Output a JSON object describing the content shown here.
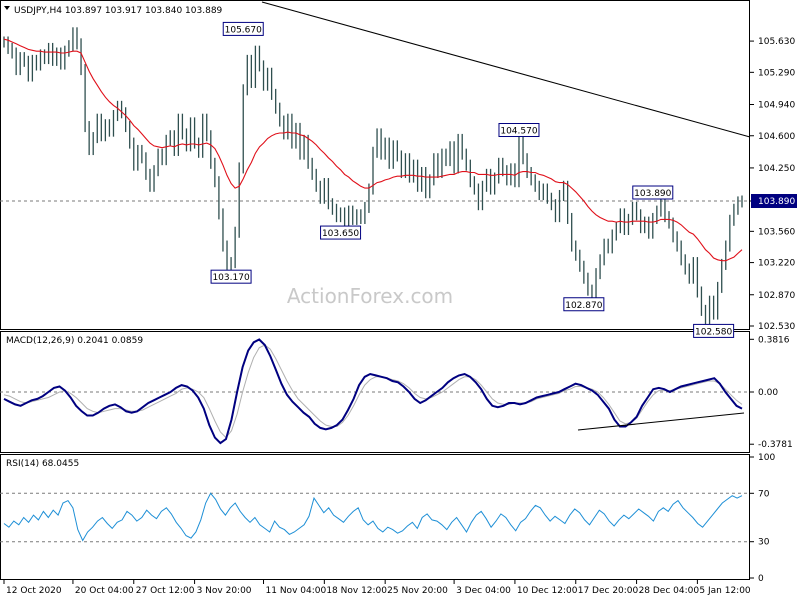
{
  "colors": {
    "price_bar": "#2f4f4f",
    "ma_line": "#e0101a",
    "macd_line": "#000080",
    "signal_line": "#b0b0b0",
    "rsi_line": "#1e8fd6",
    "trendline": "#000000",
    "label_border": "#000080",
    "current_price_bg": "#000080",
    "grid_dashed": "#7a7a7a"
  },
  "watermark": "ActionForex.com",
  "chart_data": [
    {
      "type": "line",
      "title": "USDJPY,H4 103.897 103.917 103.840 103.889",
      "y_ticks": [
        "105.630",
        "105.290",
        "104.940",
        "104.600",
        "104.250",
        "103.890",
        "103.560",
        "103.220",
        "102.870",
        "102.530"
      ],
      "ylim": [
        102.53,
        105.99
      ],
      "current_price": "103.890",
      "annotations": [
        {
          "label": "105.670",
          "x_index": 59,
          "y": 105.67
        },
        {
          "label": "103.170",
          "x_index": 56,
          "y": 103.17
        },
        {
          "label": "103.650",
          "x_index": 83,
          "y": 103.65
        },
        {
          "label": "104.570",
          "x_index": 127,
          "y": 104.57
        },
        {
          "label": "102.870",
          "x_index": 143,
          "y": 102.87
        },
        {
          "label": "103.890",
          "x_index": 160,
          "y": 103.89
        },
        {
          "label": "102.580",
          "x_index": 175,
          "y": 102.58
        }
      ],
      "series": [
        {
          "values": [
            105.62,
            105.55,
            105.5,
            105.32,
            105.45,
            105.41,
            105.25,
            105.42,
            105.37,
            105.48,
            105.44,
            105.55,
            105.42,
            105.5,
            105.38,
            105.52,
            105.58,
            105.72,
            105.6,
            105.32,
            104.7,
            104.45,
            104.58,
            104.78,
            104.6,
            104.72,
            104.65,
            104.82,
            104.92,
            104.85,
            104.7,
            104.52,
            104.28,
            104.44,
            104.36,
            104.18,
            104.05,
            104.22,
            104.4,
            104.34,
            104.55,
            104.6,
            104.44,
            104.78,
            104.62,
            104.49,
            104.74,
            104.52,
            104.42,
            104.78,
            104.6,
            104.3,
            104.1,
            103.75,
            103.4,
            103.2,
            103.22,
            103.55,
            104.25,
            105.1,
            105.42,
            105.18,
            105.52,
            105.36,
            105.15,
            105.28,
            105.05,
            104.9,
            104.76,
            104.62,
            104.78,
            104.52,
            104.68,
            104.4,
            104.55,
            104.3,
            104.18,
            104.05,
            103.92,
            104.08,
            103.86,
            103.8,
            103.72,
            103.76,
            103.65,
            103.78,
            103.69,
            103.74,
            103.7,
            103.82,
            104.02,
            104.42,
            104.62,
            104.4,
            104.52,
            104.3,
            104.49,
            104.38,
            104.2,
            104.35,
            104.15,
            104.28,
            104.05,
            104.2,
            103.98,
            104.12,
            104.35,
            104.2,
            104.4,
            104.33,
            104.48,
            104.25,
            104.56,
            104.4,
            104.28,
            104.1,
            104.02,
            103.85,
            104.05,
            104.18,
            104.02,
            104.14,
            104.3,
            104.22,
            104.12,
            104.24,
            104.1,
            104.57,
            104.35,
            104.2,
            104.12,
            104.05,
            103.96,
            104.02,
            103.92,
            103.85,
            103.72,
            103.95,
            104.05,
            103.7,
            103.4,
            103.3,
            103.18,
            103.05,
            102.92,
            102.87,
            103.1,
            103.25,
            103.42,
            103.38,
            103.52,
            103.6,
            103.75,
            103.58,
            103.69,
            103.82,
            103.74,
            103.6,
            103.66,
            103.54,
            103.7,
            103.78,
            103.89,
            103.72,
            103.65,
            103.5,
            103.4,
            103.25,
            103.15,
            103.05,
            103.22,
            102.9,
            102.7,
            102.58,
            102.8,
            102.66,
            102.95,
            103.2,
            103.4,
            103.68,
            103.8,
            103.88,
            103.89
          ]
        },
        {
          "values": [
            105.65,
            105.64,
            105.62,
            105.6,
            105.58,
            105.56,
            105.54,
            105.53,
            105.52,
            105.52,
            105.51,
            105.51,
            105.51,
            105.51,
            105.5,
            105.5,
            105.51,
            105.52,
            105.52,
            105.5,
            105.4,
            105.3,
            105.22,
            105.15,
            105.08,
            105.02,
            104.97,
            104.93,
            104.9,
            104.86,
            104.82,
            104.77,
            104.71,
            104.67,
            104.62,
            104.57,
            104.52,
            104.49,
            104.48,
            104.47,
            104.48,
            104.49,
            104.48,
            104.5,
            104.51,
            104.5,
            104.51,
            104.51,
            104.5,
            104.51,
            104.52,
            104.5,
            104.46,
            104.38,
            104.28,
            104.17,
            104.08,
            104.03,
            104.05,
            104.13,
            104.23,
            104.31,
            104.41,
            104.48,
            104.52,
            104.57,
            104.6,
            104.62,
            104.63,
            104.63,
            104.64,
            104.63,
            104.63,
            104.61,
            104.6,
            104.57,
            104.54,
            104.5,
            104.45,
            104.41,
            104.36,
            104.32,
            104.27,
            104.23,
            104.18,
            104.15,
            104.11,
            104.08,
            104.05,
            104.03,
            104.03,
            104.06,
            104.09,
            104.1,
            104.12,
            104.13,
            104.15,
            104.16,
            104.16,
            104.17,
            104.17,
            104.17,
            104.16,
            104.16,
            104.15,
            104.15,
            104.15,
            104.15,
            104.16,
            104.17,
            104.18,
            104.18,
            104.2,
            104.21,
            104.21,
            104.2,
            104.2,
            104.18,
            104.18,
            104.18,
            104.17,
            104.17,
            104.18,
            104.18,
            104.18,
            104.18,
            104.17,
            104.2,
            104.21,
            104.21,
            104.2,
            104.2,
            104.18,
            104.17,
            104.15,
            104.13,
            104.1,
            104.09,
            104.09,
            104.07,
            104.03,
            103.99,
            103.94,
            103.89,
            103.83,
            103.78,
            103.74,
            103.71,
            103.69,
            103.67,
            103.67,
            103.66,
            103.67,
            103.66,
            103.66,
            103.67,
            103.67,
            103.67,
            103.67,
            103.66,
            103.66,
            103.67,
            103.69,
            103.69,
            103.69,
            103.68,
            103.66,
            103.63,
            103.59,
            103.55,
            103.53,
            103.48,
            103.42,
            103.36,
            103.32,
            103.27,
            103.25,
            103.24,
            103.24,
            103.26,
            103.28,
            103.32,
            103.36
          ]
        }
      ],
      "x_ticks": [
        {
          "label": "12 Oct 2020",
          "x_index": 0
        },
        {
          "label": "20 Oct 04:00",
          "x_index": 17
        },
        {
          "label": "27 Oct 12:00",
          "x_index": 32
        },
        {
          "label": "3 Nov 20:00",
          "x_index": 47
        },
        {
          "label": "11 Nov 04:00",
          "x_index": 64
        },
        {
          "label": "18 Nov 12:00",
          "x_index": 79
        },
        {
          "label": "25 Nov 20:00",
          "x_index": 94
        },
        {
          "label": "3 Dec 04:00",
          "x_index": 111
        },
        {
          "label": "10 Dec 12:00",
          "x_index": 126
        },
        {
          "label": "17 Dec 20:00",
          "x_index": 141
        },
        {
          "label": "28 Dec 04:00",
          "x_index": 156
        },
        {
          "label": "5 Jan 12:00",
          "x_index": 171
        }
      ]
    },
    {
      "type": "line",
      "title": "MACD(12,26,9) 0.2041 0.0859",
      "y_ticks": [
        "0.3816",
        "0.00",
        "-0.3781"
      ],
      "ylim": [
        -0.42,
        0.42
      ],
      "series": [
        {
          "values": [
            -0.05,
            -0.07,
            -0.09,
            -0.1,
            -0.08,
            -0.06,
            -0.05,
            -0.03,
            0.0,
            0.03,
            0.04,
            0.01,
            -0.04,
            -0.1,
            -0.14,
            -0.17,
            -0.17,
            -0.15,
            -0.12,
            -0.1,
            -0.09,
            -0.11,
            -0.14,
            -0.15,
            -0.14,
            -0.11,
            -0.08,
            -0.06,
            -0.04,
            -0.02,
            0.0,
            0.03,
            0.05,
            0.04,
            0.01,
            -0.04,
            -0.12,
            -0.24,
            -0.33,
            -0.37,
            -0.34,
            -0.2,
            0.0,
            0.18,
            0.3,
            0.36,
            0.38,
            0.34,
            0.26,
            0.16,
            0.06,
            -0.02,
            -0.07,
            -0.11,
            -0.15,
            -0.18,
            -0.23,
            -0.26,
            -0.27,
            -0.26,
            -0.24,
            -0.2,
            -0.13,
            -0.05,
            0.05,
            0.11,
            0.13,
            0.12,
            0.11,
            0.1,
            0.08,
            0.07,
            0.04,
            0.0,
            -0.05,
            -0.08,
            -0.06,
            -0.03,
            0.0,
            0.03,
            0.07,
            0.1,
            0.12,
            0.13,
            0.11,
            0.07,
            0.02,
            -0.05,
            -0.1,
            -0.11,
            -0.1,
            -0.08,
            -0.08,
            -0.09,
            -0.08,
            -0.06,
            -0.04,
            -0.03,
            -0.02,
            -0.01,
            0.0,
            0.02,
            0.04,
            0.06,
            0.05,
            0.03,
            0.01,
            -0.02,
            -0.07,
            -0.12,
            -0.2,
            -0.25,
            -0.25,
            -0.22,
            -0.18,
            -0.1,
            -0.04,
            0.02,
            0.03,
            0.02,
            0.0,
            0.02,
            0.04,
            0.05,
            0.06,
            0.07,
            0.08,
            0.09,
            0.1,
            0.06,
            0.0,
            -0.05,
            -0.1,
            -0.12
          ],
          "name": ""
        },
        {
          "values": [
            -0.02,
            -0.03,
            -0.05,
            -0.07,
            -0.08,
            -0.07,
            -0.06,
            -0.05,
            -0.04,
            -0.02,
            0.0,
            0.01,
            -0.01,
            -0.04,
            -0.08,
            -0.12,
            -0.14,
            -0.15,
            -0.14,
            -0.13,
            -0.12,
            -0.12,
            -0.13,
            -0.14,
            -0.14,
            -0.13,
            -0.11,
            -0.09,
            -0.07,
            -0.05,
            -0.03,
            -0.01,
            0.02,
            0.03,
            0.02,
            0.0,
            -0.04,
            -0.12,
            -0.21,
            -0.29,
            -0.33,
            -0.28,
            -0.16,
            0.0,
            0.14,
            0.25,
            0.32,
            0.34,
            0.31,
            0.24,
            0.16,
            0.08,
            0.01,
            -0.05,
            -0.09,
            -0.13,
            -0.17,
            -0.21,
            -0.24,
            -0.25,
            -0.25,
            -0.22,
            -0.17,
            -0.1,
            -0.02,
            0.05,
            0.09,
            0.11,
            0.11,
            0.1,
            0.09,
            0.08,
            0.06,
            0.03,
            -0.01,
            -0.04,
            -0.05,
            -0.04,
            -0.02,
            0.0,
            0.03,
            0.06,
            0.09,
            0.11,
            0.11,
            0.09,
            0.05,
            0.0,
            -0.05,
            -0.08,
            -0.09,
            -0.09,
            -0.08,
            -0.08,
            -0.08,
            -0.07,
            -0.05,
            -0.04,
            -0.03,
            -0.02,
            -0.01,
            0.01,
            0.02,
            0.04,
            0.04,
            0.03,
            0.02,
            0.0,
            -0.04,
            -0.09,
            -0.15,
            -0.21,
            -0.23,
            -0.22,
            -0.19,
            -0.13,
            -0.07,
            -0.02,
            0.01,
            0.01,
            0.01,
            0.02,
            0.03,
            0.04,
            0.05,
            0.06,
            0.07,
            0.08,
            0.08,
            0.06,
            0.02,
            -0.02,
            -0.06,
            -0.09
          ],
          "name": ""
        }
      ]
    },
    {
      "type": "line",
      "title": "RSI(14) 68.0455",
      "y_ticks": [
        "100",
        "70",
        "30",
        "0"
      ],
      "ylim": [
        0,
        100
      ],
      "series": [
        {
          "values": [
            45,
            42,
            47,
            44,
            50,
            46,
            52,
            48,
            55,
            50,
            56,
            52,
            62,
            64,
            58,
            40,
            31,
            38,
            42,
            47,
            50,
            45,
            41,
            46,
            48,
            55,
            52,
            47,
            50,
            56,
            52,
            49,
            55,
            58,
            53,
            46,
            41,
            35,
            33,
            38,
            48,
            62,
            70,
            65,
            57,
            52,
            58,
            62,
            55,
            50,
            46,
            50,
            44,
            41,
            38,
            47,
            42,
            40,
            36,
            38,
            41,
            44,
            51,
            66,
            60,
            54,
            58,
            52,
            49,
            46,
            51,
            55,
            58,
            48,
            44,
            47,
            41,
            38,
            42,
            40,
            37,
            39,
            43,
            46,
            41,
            50,
            53,
            48,
            47,
            44,
            40,
            46,
            50,
            44,
            38,
            46,
            52,
            55,
            49,
            42,
            47,
            53,
            50,
            44,
            39,
            46,
            49,
            55,
            60,
            58,
            52,
            47,
            51,
            48,
            45,
            52,
            57,
            54,
            48,
            44,
            50,
            56,
            53,
            47,
            43,
            48,
            52,
            49,
            53,
            57,
            54,
            51,
            47,
            55,
            58,
            55,
            61,
            64,
            58,
            54,
            50,
            45,
            42,
            47,
            52,
            57,
            62,
            65,
            68,
            66,
            68
          ],
          "name": ""
        }
      ],
      "x_ticks": []
    }
  ]
}
